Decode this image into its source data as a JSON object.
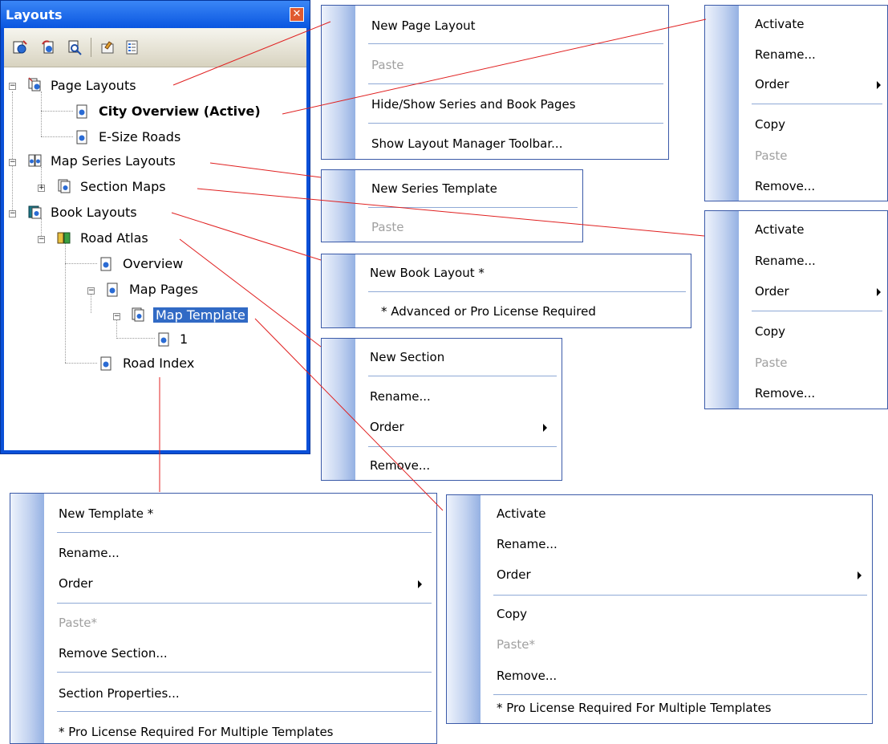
{
  "panel": {
    "title": "Layouts",
    "tree": {
      "page_layouts": "Page Layouts",
      "city_overview": "City Overview (Active)",
      "e_size_roads": "E-Size Roads",
      "map_series_layouts": "Map Series Layouts",
      "section_maps": "Section Maps",
      "book_layouts": "Book Layouts",
      "road_atlas": "Road Atlas",
      "overview": "Overview",
      "map_pages": "Map Pages",
      "map_template": "Map Template",
      "page_1": "1",
      "road_index": "Road Index"
    },
    "toolbar_icons": [
      "new-page-layout-icon",
      "new-series-icon",
      "zoom-layout-icon",
      "properties-icon",
      "list-view-icon"
    ]
  },
  "menus": {
    "page_layouts": {
      "new": "New Page Layout",
      "paste": "Paste",
      "hide_show": "Hide/Show Series and Book Pages",
      "show_toolbar": "Show Layout Manager Toolbar..."
    },
    "active_layout": {
      "activate": "Activate",
      "rename": "Rename...",
      "order": "Order",
      "copy": "Copy",
      "paste": "Paste",
      "remove": "Remove..."
    },
    "map_series": {
      "new": "New Series Template",
      "paste": "Paste"
    },
    "section_maps": {
      "activate": "Activate",
      "rename": "Rename...",
      "order": "Order",
      "copy": "Copy",
      "paste": "Paste",
      "remove": "Remove..."
    },
    "book_layouts": {
      "new": "New Book Layout *",
      "note": "* Advanced or Pro License Required"
    },
    "road_atlas": {
      "new": "New Section",
      "rename": "Rename...",
      "order": "Order",
      "remove": "Remove..."
    },
    "road_index": {
      "new": "New Template *",
      "rename": "Rename...",
      "order": "Order",
      "paste": "Paste*",
      "remove_section": "Remove Section...",
      "section_props": "Section Properties...",
      "note": "* Pro License Required For Multiple Templates"
    },
    "map_template": {
      "activate": "Activate",
      "rename": "Rename...",
      "order": "Order",
      "copy": "Copy",
      "paste": "Paste*",
      "remove": "Remove...",
      "note": "* Pro License Required For Multiple Templates"
    }
  },
  "colors": {
    "panel_blue": "#0a50d8",
    "callout_red": "#e02020",
    "selection": "#316ac5",
    "disabled": "#a0a0a0"
  }
}
